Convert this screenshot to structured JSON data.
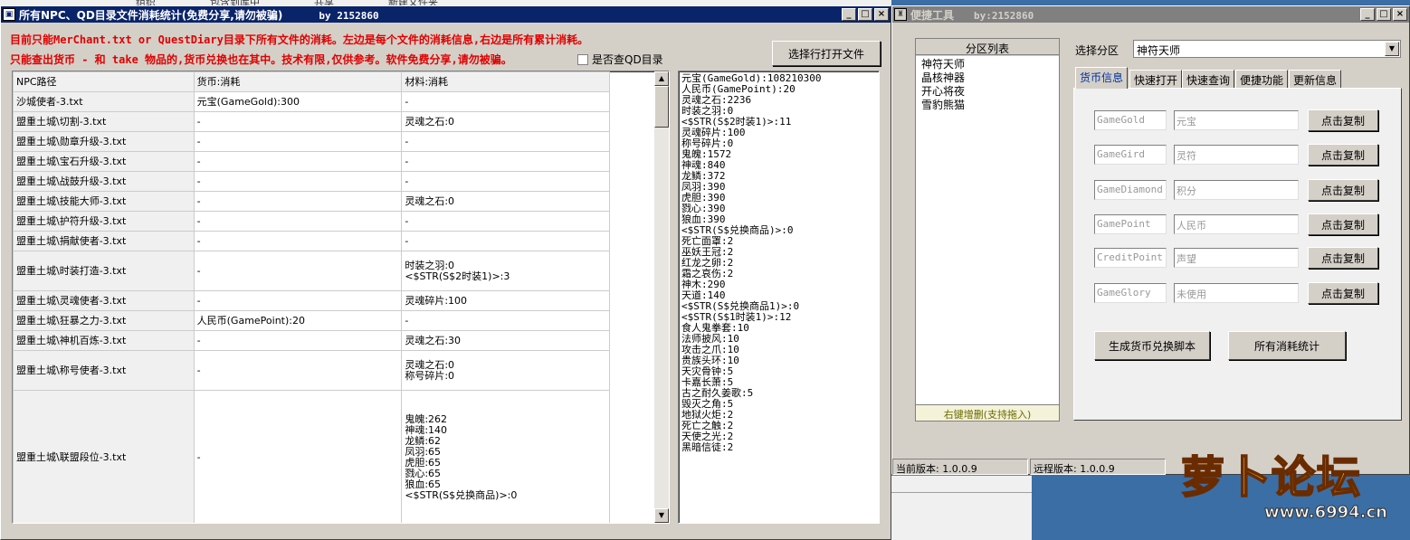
{
  "taskbar": {
    "items": [
      "组织",
      "包含到库中",
      "共享",
      "新建文件夹"
    ]
  },
  "main_window": {
    "title": "所有NPC、QD目录文件消耗统计(免费分享,请勿被骗)",
    "by": "by 2152860",
    "notice1": "目前只能MerChant.txt or QuestDiary目录下所有文件的消耗。左边是每个文件的消耗信息,右边是所有累计消耗。",
    "notice2": "只能查出货币 - 和 take 物品的,货币兑换也在其中。技术有限,仅供参考。软件免费分享,请勿被骗。",
    "open_btn": "选择行打开文件",
    "qd_checkbox": "是否查QD目录",
    "columns": [
      "NPC路径",
      "货币:消耗",
      "材料:消耗"
    ],
    "rows": [
      {
        "path": "沙城使者-3.txt",
        "currency": "元宝(GameGold):300",
        "material": "-"
      },
      {
        "path": "盟重土城\\切割-3.txt",
        "currency": "-",
        "material": "灵魂之石:0"
      },
      {
        "path": "盟重土城\\勋章升级-3.txt",
        "currency": "-",
        "material": "-"
      },
      {
        "path": "盟重土城\\宝石升级-3.txt",
        "currency": "-",
        "material": "-"
      },
      {
        "path": "盟重土城\\战鼓升级-3.txt",
        "currency": "-",
        "material": "-"
      },
      {
        "path": "盟重土城\\技能大师-3.txt",
        "currency": "-",
        "material": "灵魂之石:0"
      },
      {
        "path": "盟重土城\\护符升级-3.txt",
        "currency": "-",
        "material": "-"
      },
      {
        "path": "盟重土城\\捐献使者-3.txt",
        "currency": "-",
        "material": "-"
      },
      {
        "path": "盟重土城\\时装打造-3.txt",
        "currency": "-",
        "material": "时装之羽:0\n<$STR(S$2时装1)>:3"
      },
      {
        "path": "盟重土城\\灵魂使者-3.txt",
        "currency": "-",
        "material": "灵魂碎片:100"
      },
      {
        "path": "盟重土城\\狂暴之力-3.txt",
        "currency": "人民币(GamePoint):20",
        "material": "-"
      },
      {
        "path": "盟重土城\\神机百炼-3.txt",
        "currency": "-",
        "material": "灵魂之石:30"
      },
      {
        "path": "盟重土城\\称号使者-3.txt",
        "currency": "-",
        "material": "灵魂之石:0\n称号碎片:0"
      },
      {
        "path": "盟重土城\\联盟段位-3.txt",
        "currency": "-",
        "material": "鬼魄:262\n神魂:140\n龙鳞:62\n凤羽:65\n虎胆:65\n戮心:65\n狼血:65\n<$STR(S$兑换商品)>:0"
      }
    ],
    "totals": [
      "元宝(GameGold):108210300",
      "人民币(GamePoint):20",
      "灵魂之石:2236",
      "时装之羽:0",
      "<$STR(S$2时装1)>:11",
      "灵魂碎片:100",
      "称号碎片:0",
      "鬼魄:1572",
      "神魂:840",
      "龙鳞:372",
      "凤羽:390",
      "虎胆:390",
      "戮心:390",
      "狼血:390",
      "<$STR(S$兑换商品)>:0",
      "死亡面罩:2",
      "巫妖王冠:2",
      "红龙之卵:2",
      "霜之哀伤:2",
      "神木:290",
      "天道:140",
      "<$STR(S$兑换商品1)>:0",
      "<$STR(S$1时装1)>:12",
      "食人鬼拳套:10",
      "法师披风:10",
      "攻击之爪:10",
      "贵族头环:10",
      "天灾骨钟:5",
      "卡嘉长萧:5",
      "古之耐久姜歌:5",
      "毁灭之角:5",
      "地狱火炬:2",
      "死亡之触:2",
      "天使之光:2",
      "黑暗信徒:2"
    ]
  },
  "tool_window": {
    "title": "便捷工具",
    "by": "by:2152860",
    "partition_header": "分区列表",
    "partitions": [
      "神符天师",
      "晶核神器",
      "开心将夜",
      "雪豹熊猫"
    ],
    "partition_footer": "右键增删(支持拖入)",
    "select_label": "选择分区",
    "select_value": "神符天师",
    "tabs": [
      "货币信息",
      "快速打开",
      "快速查询",
      "便捷功能",
      "更新信息"
    ],
    "currencies": [
      {
        "code": "GameGold",
        "name": "元宝"
      },
      {
        "code": "GameGird",
        "name": "灵符"
      },
      {
        "code": "GameDiamond",
        "name": "积分"
      },
      {
        "code": "GamePoint",
        "name": "人民币"
      },
      {
        "code": "CreditPoint",
        "name": "声望"
      },
      {
        "code": "GameGlory",
        "name": "未使用"
      }
    ],
    "copy_btn": "点击复制",
    "gen_btn": "生成货币兑换脚本",
    "stats_btn": "所有消耗统计",
    "current_version": "当前版本: 1.0.0.9",
    "remote_version": "远程版本: 1.0.0.9"
  },
  "watermark": {
    "text": "萝卜论坛",
    "url": "www.6994.cn"
  }
}
